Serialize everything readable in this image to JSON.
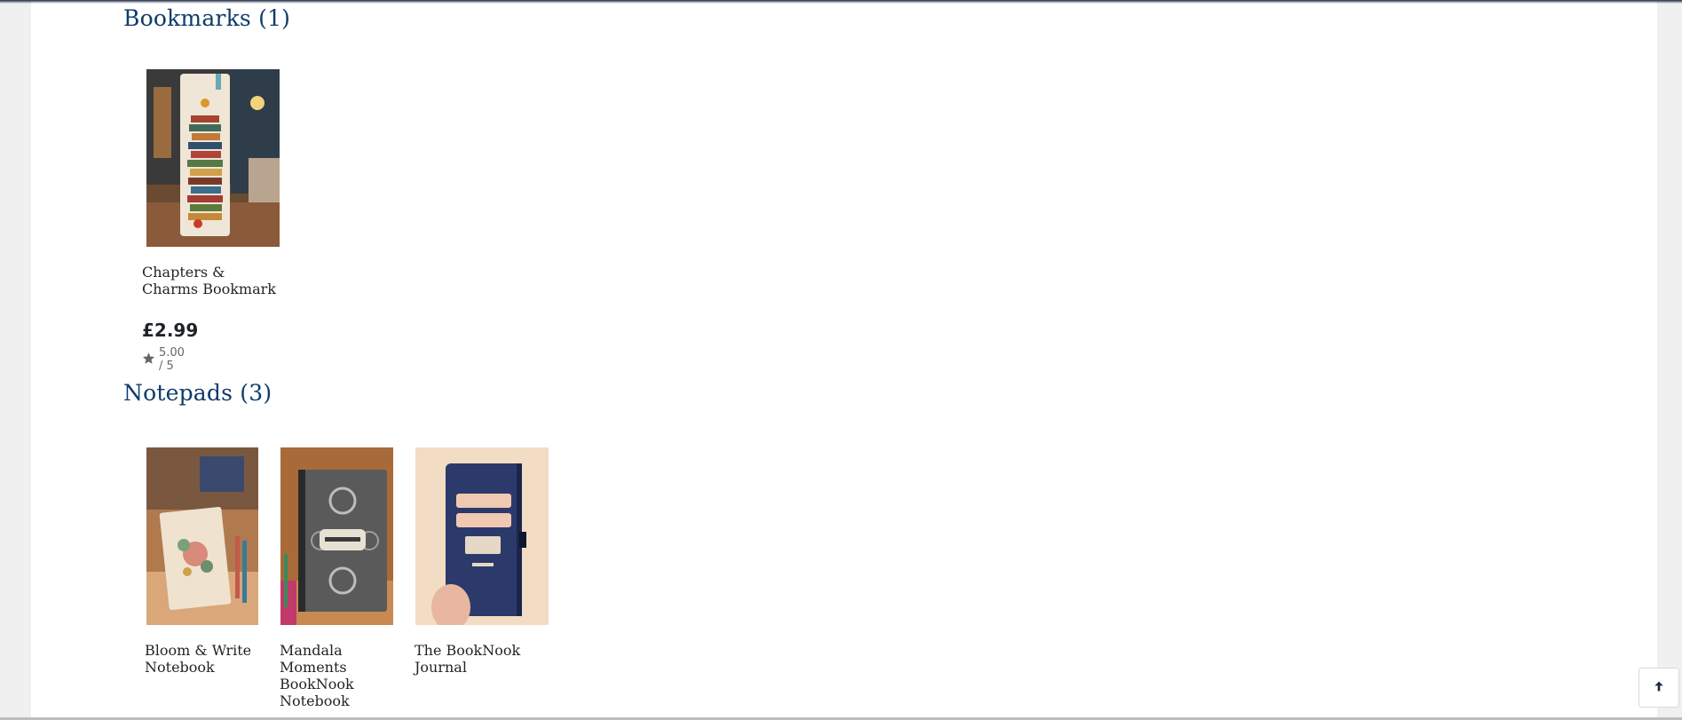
{
  "sections": [
    {
      "title": "Bookmarks (1)",
      "products": [
        {
          "name": "Chapters & Charms Bookmark",
          "price": "£2.99",
          "rating": "5.00 / 5"
        }
      ]
    },
    {
      "title": "Notepads (3)",
      "products": [
        {
          "name": "Bloom & Write Notebook"
        },
        {
          "name": "Mandala Moments BookNook Notebook"
        },
        {
          "name": "The BookNook Journal"
        }
      ]
    }
  ],
  "icons": {
    "star": "star-icon",
    "scroll_top": "arrow-up-icon"
  },
  "colors": {
    "heading": "#0e3b6b",
    "background": "#ffffff",
    "page_gutter": "#f0f0f0"
  }
}
